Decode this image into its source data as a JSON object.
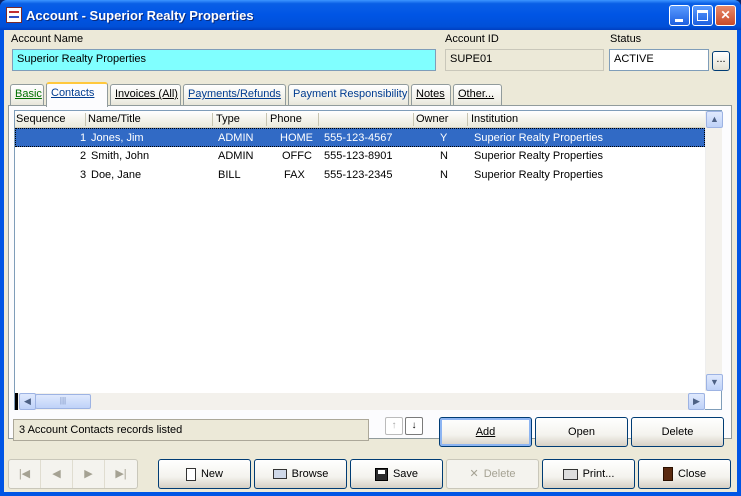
{
  "window": {
    "title": "Account  - Superior Realty Properties",
    "controls": [
      "minimize",
      "maximize",
      "close"
    ]
  },
  "header": {
    "account_name_label": "Account Name",
    "account_name_value": "Superior Realty Properties",
    "account_id_label": "Account ID",
    "account_id_value": "SUPE01",
    "status_label": "Status",
    "status_value": "ACTIVE",
    "status_button": "..."
  },
  "tabs": [
    {
      "label": "Basic",
      "active": false
    },
    {
      "label": "Contacts",
      "active": true
    },
    {
      "label": "Invoices (All)",
      "active": false
    },
    {
      "label": "Payments/Refunds",
      "active": false
    },
    {
      "label": "Payment Responsibility",
      "active": false
    },
    {
      "label": "Notes",
      "active": false
    },
    {
      "label": "Other...",
      "active": false
    }
  ],
  "grid": {
    "columns": [
      "Sequence",
      "Name/Title",
      "Type",
      "Phone",
      "",
      "Owner",
      "Institution"
    ],
    "rows": [
      {
        "seq": "1",
        "name": "Jones, Jim",
        "type": "ADMIN",
        "phone_type": "HOME",
        "phone": "555-123-4567",
        "owner": "Y",
        "institution": "Superior Realty Properties",
        "selected": true
      },
      {
        "seq": "2",
        "name": "Smith, John",
        "type": "ADMIN",
        "phone_type": "OFFC",
        "phone": "555-123-8901",
        "owner": "N",
        "institution": "Superior Realty Properties",
        "selected": false
      },
      {
        "seq": "3",
        "name": "Doe, Jane",
        "type": "BILL",
        "phone_type": "FAX",
        "phone": "555-123-2345",
        "owner": "N",
        "institution": "Superior Realty Properties",
        "selected": false
      }
    ]
  },
  "status_text": "3 Account Contacts records listed",
  "grid_actions": {
    "add": "Add",
    "open": "Open",
    "delete": "Delete"
  },
  "toolbar": {
    "new": "New",
    "browse": "Browse",
    "save": "Save",
    "delete": "Delete",
    "print": "Print...",
    "close": "Close"
  },
  "colors": {
    "titlebar": "#0055e5",
    "account_name_bg": "#80ffff",
    "selected_row": "#316ac5",
    "window_bg": "#ece9d8"
  }
}
